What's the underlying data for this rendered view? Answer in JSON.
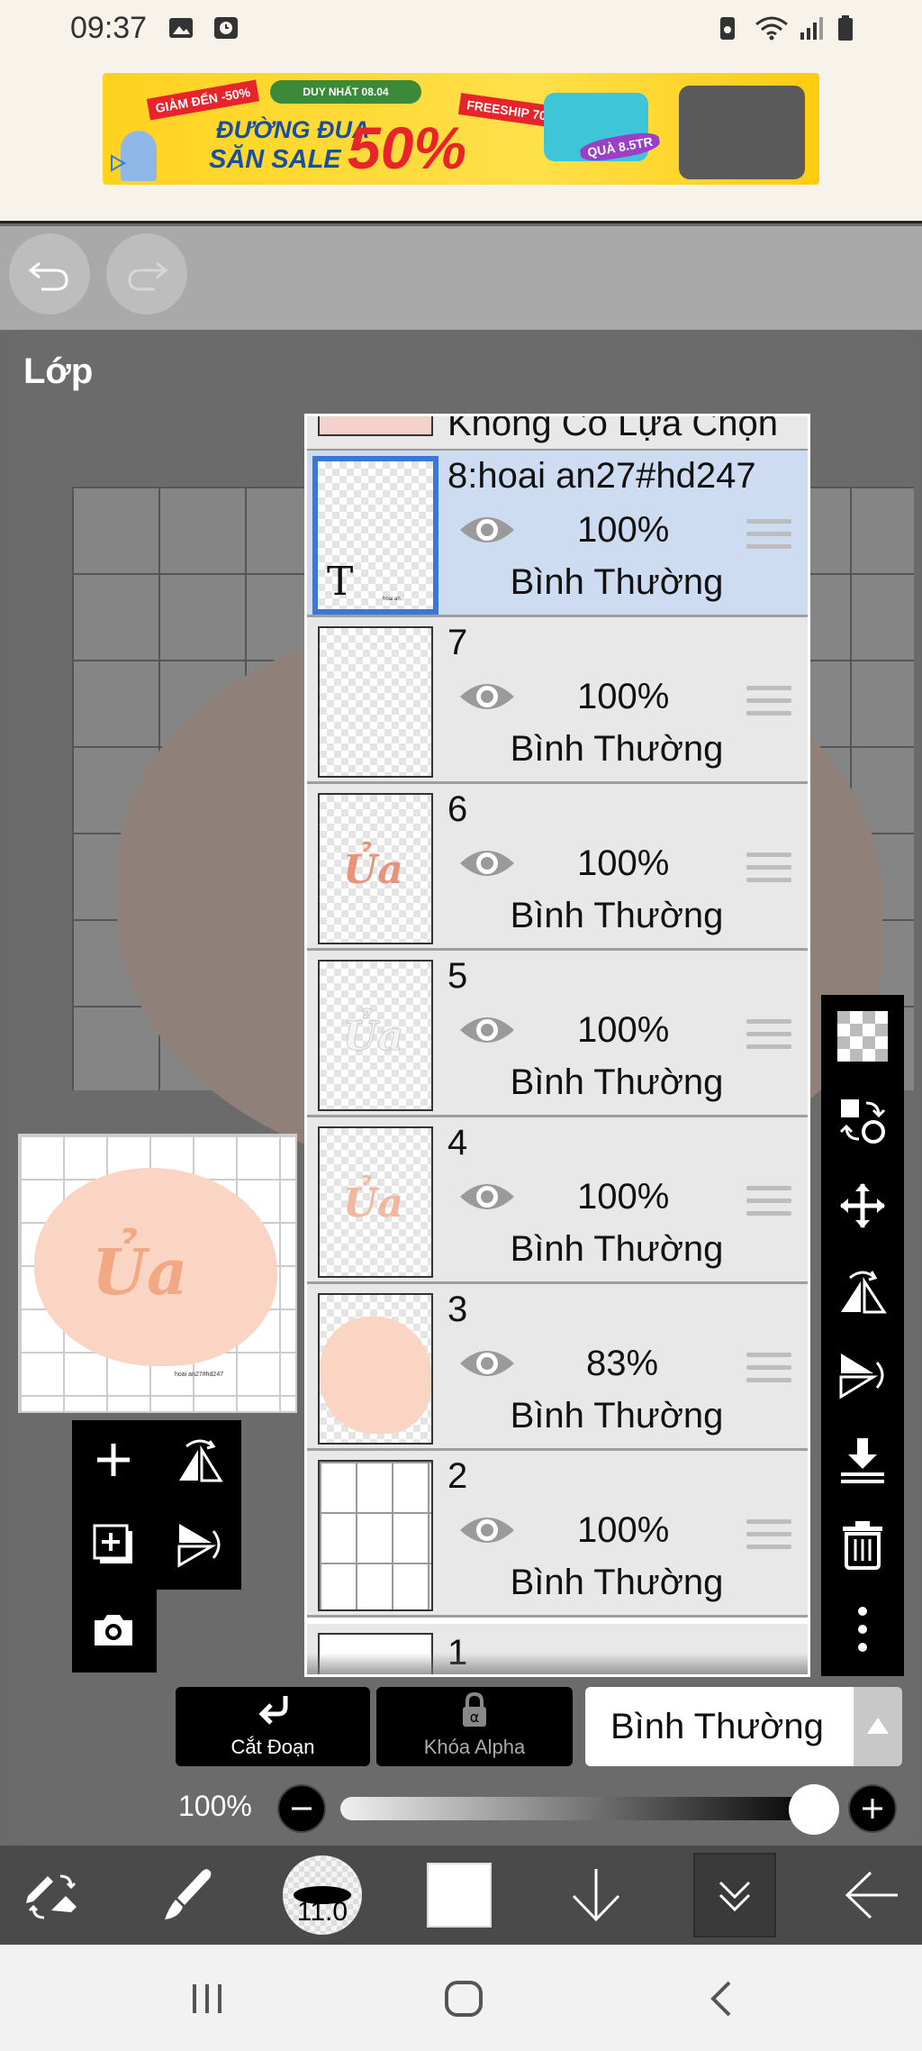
{
  "status_bar": {
    "time": "09:37",
    "icons": [
      "image-icon",
      "clock-app-icon",
      "battery-saver-icon",
      "wifi-icon",
      "signal-icon",
      "battery-icon"
    ]
  },
  "ad": {
    "badge_discount": "GIẢM ĐẾN -50%",
    "pill_text": "DUY NHẤT 08.04",
    "line1": "ĐƯỜNG ĐUA",
    "line2": "SĂN SALE",
    "big_text": "50%",
    "badge_right": "FREESHIP 70K",
    "gift_text": "QUÀ 8.5TR"
  },
  "panel": {
    "title": "Lớp"
  },
  "thumbnail": {
    "text": "Ủa",
    "signature": "hoai an27#hd247"
  },
  "layers": {
    "peek_label": "Không Có Lựa Chọn",
    "items": [
      {
        "name": "8:hoai an27#hd247",
        "opacity": "100%",
        "blend": "Bình Thường",
        "selected": true,
        "thumb_T": "T",
        "thumb_small": "hoai an.."
      },
      {
        "name": "7",
        "opacity": "100%",
        "blend": "Bình Thường"
      },
      {
        "name": "6",
        "opacity": "100%",
        "blend": "Bình Thường",
        "thumb_text": "Ủa"
      },
      {
        "name": "5",
        "opacity": "100%",
        "blend": "Bình Thường",
        "thumb_text": "Ủa"
      },
      {
        "name": "4",
        "opacity": "100%",
        "blend": "Bình Thường",
        "thumb_text": "Ủa"
      },
      {
        "name": "3",
        "opacity": "83%",
        "blend": "Bình Thường"
      },
      {
        "name": "2",
        "opacity": "100%",
        "blend": "Bình Thường"
      }
    ],
    "last_name": "1"
  },
  "bottom": {
    "clip_label": "Cắt Đoạn",
    "alpha_lock_label": "Khóa Alpha",
    "blend_mode": "Bình Thường",
    "opacity_label": "100%",
    "opacity_value": 1.0
  },
  "toolbar": {
    "brush_size": "11.0"
  },
  "colors": {
    "selected_row": "#cddcf0",
    "selected_border": "#3a78d6",
    "panel_bg": "#6b6b6b",
    "peach": "#fbd5c4",
    "ua_color": "#f2a883"
  }
}
